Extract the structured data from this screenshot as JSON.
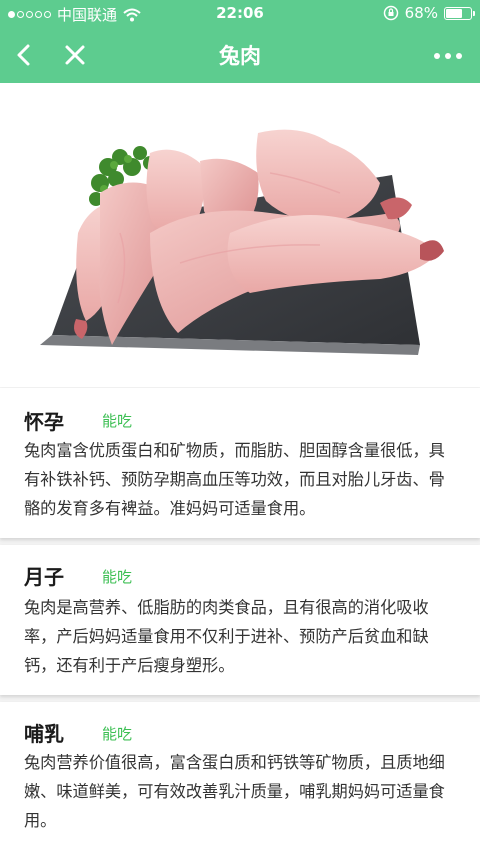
{
  "status_bar": {
    "carrier": "中国联通",
    "time": "22:06",
    "battery": "68%",
    "battery_level": 0.68,
    "signal_bars": 1,
    "signal_total": 5
  },
  "nav": {
    "title": "兔肉",
    "back_icon": "chevron-left-icon",
    "close_icon": "close-icon",
    "more_icon": "more-icon"
  },
  "hero_image": {
    "alt": "兔肉"
  },
  "sections": [
    {
      "title": "怀孕",
      "tag": "能吃",
      "body": "兔肉富含优质蛋白和矿物质，而脂肪、胆固醇含量很低，具有补铁补钙、预防孕期高血压等功效，而且对胎儿牙齿、骨骼的发育多有裨益。准妈妈可适量食用。"
    },
    {
      "title": "月子",
      "tag": "能吃",
      "body": "兔肉是高营养、低脂肪的肉类食品，且有很高的消化吸收率，产后妈妈适量食用不仅利于进补、预防产后贫血和缺钙，还有利于产后瘦身塑形。"
    },
    {
      "title": "哺乳",
      "tag": "能吃",
      "body": "兔肉营养价值很高，富含蛋白质和钙铁等矿物质，且质地细嫩、味道鲜美，可有效改善乳汁质量，哺乳期妈妈可适量食用。"
    }
  ],
  "colors": {
    "theme_green": "#5dcc8f",
    "tag_green": "#3cbf53"
  }
}
